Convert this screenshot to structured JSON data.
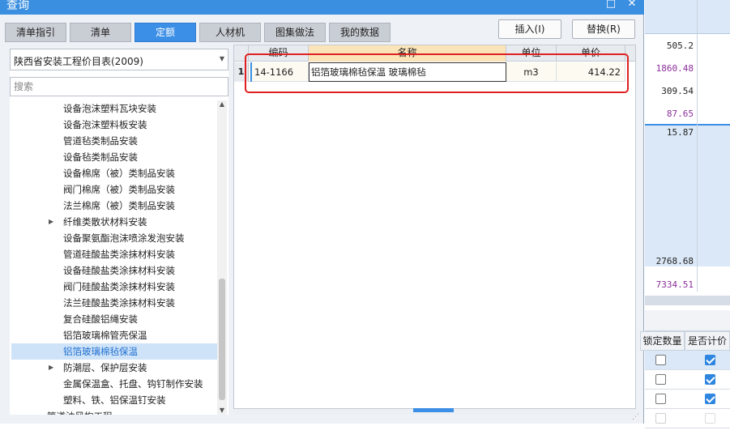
{
  "window": {
    "title": "查询",
    "min_icon": "□",
    "close_icon": "✕"
  },
  "tabs": [
    "清单指引",
    "清单",
    "定额",
    "人材机",
    "图集做法",
    "我的数据"
  ],
  "active_tab": "定额",
  "buttons": {
    "insert": "插入(I)",
    "replace": "替换(R)"
  },
  "library_select": {
    "value": "陕西省安装工程价目表(2009)"
  },
  "search": {
    "placeholder": "搜索"
  },
  "tree": [
    {
      "label": "设备泡沫塑料瓦块安装"
    },
    {
      "label": "设备泡沫塑料板安装"
    },
    {
      "label": "管道毡类制品安装"
    },
    {
      "label": "设备毡类制品安装"
    },
    {
      "label": "设备棉席（被）类制品安装"
    },
    {
      "label": "阀门棉席（被）类制品安装"
    },
    {
      "label": "法兰棉席（被）类制品安装"
    },
    {
      "label": "纤维类散状材料安装",
      "expandable": true
    },
    {
      "label": "设备聚氨酯泡沫喷涂发泡安装"
    },
    {
      "label": "管道硅酸盐类涂抹材料安装"
    },
    {
      "label": "设备硅酸盐类涂抹材料安装"
    },
    {
      "label": "阀门硅酸盐类涂抹材料安装"
    },
    {
      "label": "法兰硅酸盐类涂抹材料安装"
    },
    {
      "label": "复合硅酸铝绳安装"
    },
    {
      "label": "铝箔玻璃棉管壳保温"
    },
    {
      "label": "铝箔玻璃棉毡保温",
      "selected": true
    },
    {
      "label": "防潮层、保护层安装",
      "expandable": true
    },
    {
      "label": "金属保温盒、托盘、钩钉制作安装"
    },
    {
      "label": "塑料、铁、铝保温钉安装"
    },
    {
      "label": "管道油风构工程"
    }
  ],
  "grid": {
    "columns": {
      "code": "编码",
      "name": "名称",
      "unit": "单位",
      "price": "单价"
    },
    "rows": [
      {
        "num": "1",
        "code": "14-1166",
        "name": "铝箔玻璃棉毡保温 玻璃棉毡",
        "unit": "m3",
        "price": "414.22"
      }
    ]
  },
  "background_panel": {
    "values": [
      {
        "text": "505.2",
        "color": "#222222"
      },
      {
        "text": "1860.48",
        "color": "#8a2f9a"
      },
      {
        "text": "309.54",
        "color": "#222222"
      },
      {
        "text": "87.65",
        "color": "#8a2f9a"
      },
      {
        "text": "15.87",
        "color": "#222222"
      },
      {
        "text": "2768.68",
        "color": "#222222"
      },
      {
        "text": "7334.51",
        "color": "#8a2f9a"
      }
    ],
    "headers": {
      "fixed_qty": "锁定数量",
      "is_priced": "是否计价"
    },
    "checkbox_rows": [
      {
        "fixed": false,
        "priced": true
      },
      {
        "fixed": false,
        "priced": true
      },
      {
        "fixed": false,
        "priced": true
      },
      {
        "fixed": false,
        "priced": true,
        "disabled": true
      }
    ]
  },
  "colors": {
    "accent": "#3c8fe6",
    "highlight": "#e02020"
  }
}
